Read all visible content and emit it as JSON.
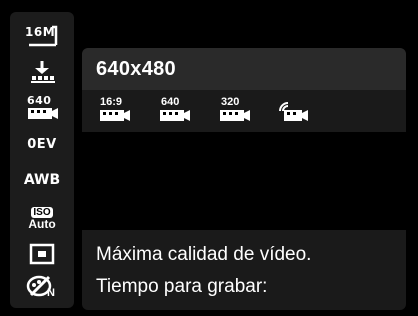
{
  "sidebar": {
    "items": [
      {
        "name": "image-size-icon",
        "label": "16M"
      },
      {
        "name": "quality-icon",
        "label": ""
      },
      {
        "name": "movie-size-icon",
        "label": "640"
      },
      {
        "name": "exposure-icon",
        "label": "0EV"
      },
      {
        "name": "white-balance-icon",
        "label": "AWB"
      },
      {
        "name": "iso-icon",
        "label": "ISO",
        "sublabel": "Auto"
      },
      {
        "name": "metering-icon",
        "label": ""
      },
      {
        "name": "color-effect-icon",
        "label": "N"
      }
    ]
  },
  "menu": {
    "title": "640x480",
    "options": [
      {
        "name": "movie-16-9-option",
        "label": "16:9"
      },
      {
        "name": "movie-640-option",
        "label": "640"
      },
      {
        "name": "movie-320-option",
        "label": "320"
      },
      {
        "name": "movie-web-option",
        "label": ""
      }
    ]
  },
  "info": {
    "line1": "Máxima calidad de vídeo.",
    "line2": "Tiempo para grabar:"
  }
}
